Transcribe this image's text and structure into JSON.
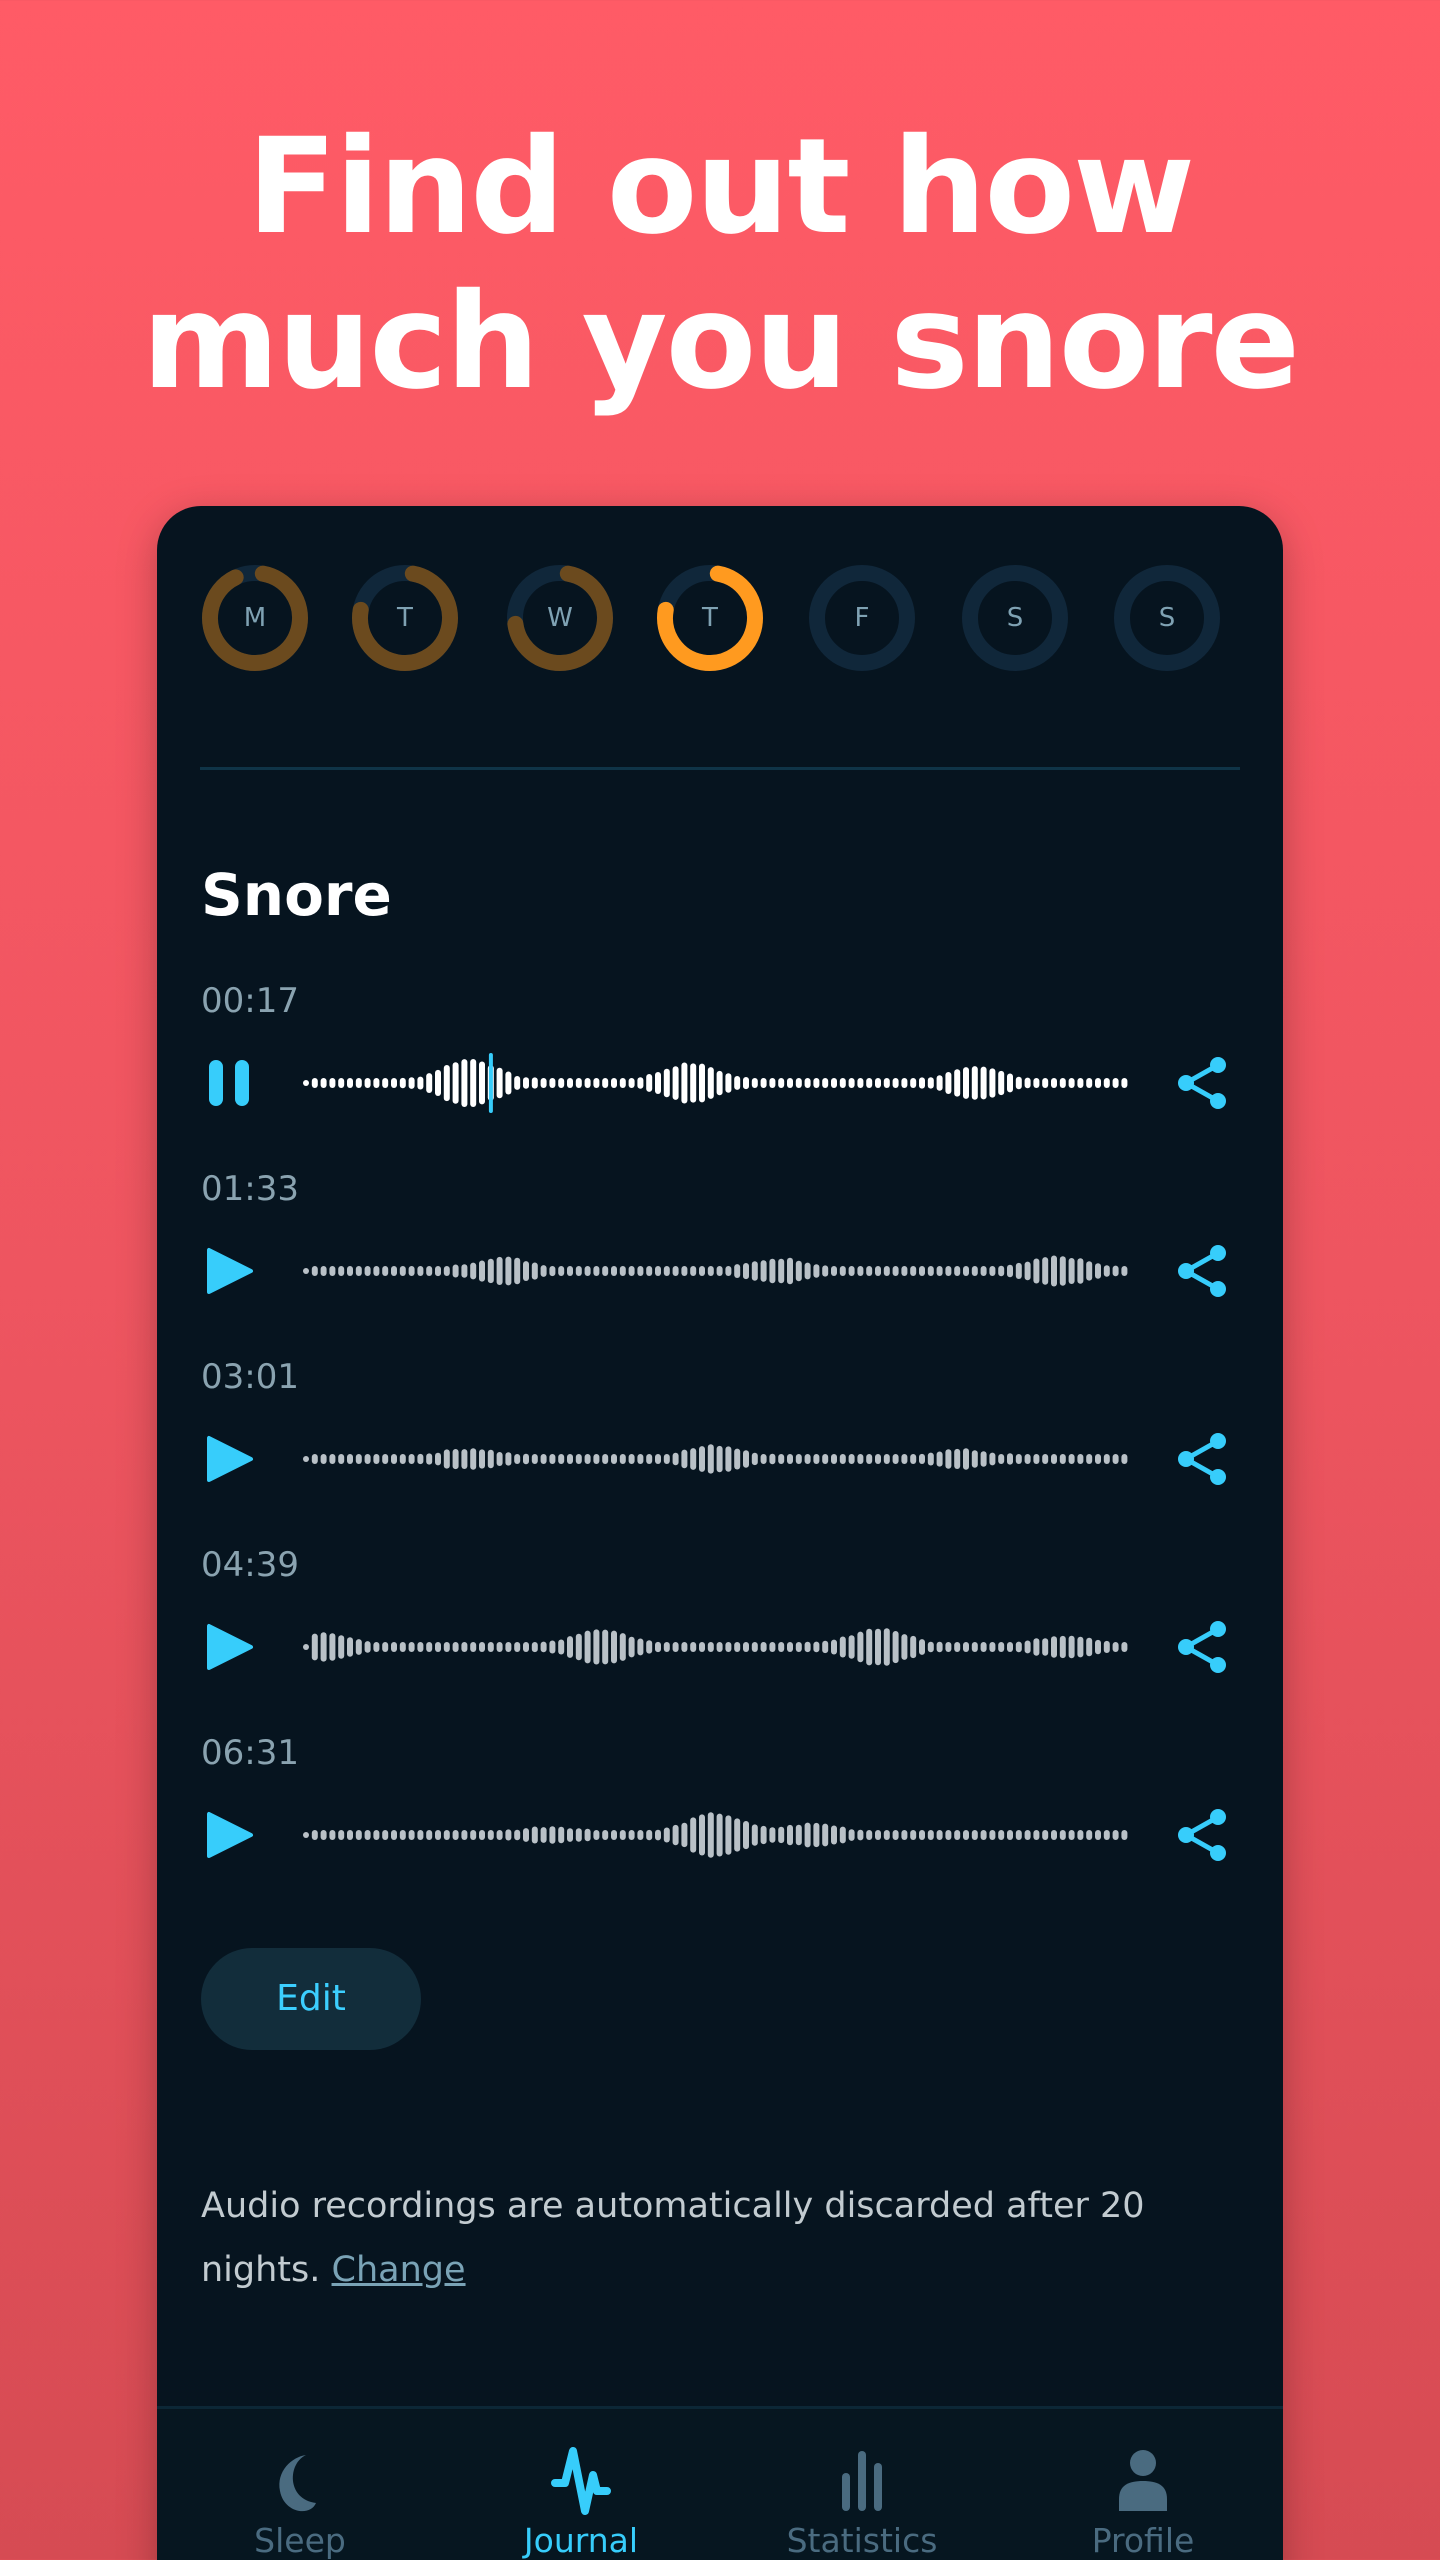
{
  "headline": {
    "line1": "Find out how",
    "line2": "much you snore"
  },
  "week": [
    {
      "day": "M",
      "progress": 0.9,
      "state": "past"
    },
    {
      "day": "T",
      "progress": 0.75,
      "state": "past"
    },
    {
      "day": "W",
      "progress": 0.7,
      "state": "past"
    },
    {
      "day": "T",
      "progress": 0.75,
      "state": "current"
    },
    {
      "day": "F",
      "progress": 0,
      "state": "future"
    },
    {
      "day": "S",
      "progress": 0,
      "state": "future"
    },
    {
      "day": "S",
      "progress": 0,
      "state": "future"
    }
  ],
  "colors": {
    "past": "#6b4a1e",
    "current": "#ff9a1f",
    "track": "#10273a",
    "accent": "#37cdfb"
  },
  "section_title": "Snore",
  "recordings": [
    {
      "time": "00:17",
      "state": "playing",
      "playback_progress": 0.23
    },
    {
      "time": "01:33",
      "state": "paused"
    },
    {
      "time": "03:01",
      "state": "paused"
    },
    {
      "time": "04:39",
      "state": "paused"
    },
    {
      "time": "06:31",
      "state": "paused"
    }
  ],
  "edit_label": "Edit",
  "footer": {
    "text": "Audio recordings are automatically discarded after 20 nights.",
    "link": "Change"
  },
  "nav": [
    {
      "label": "Sleep",
      "icon": "moon-icon",
      "active": false
    },
    {
      "label": "Journal",
      "icon": "pulse-icon",
      "active": true
    },
    {
      "label": "Statistics",
      "icon": "bar-chart-icon",
      "active": false
    },
    {
      "label": "Profile",
      "icon": "person-icon",
      "active": false
    }
  ]
}
